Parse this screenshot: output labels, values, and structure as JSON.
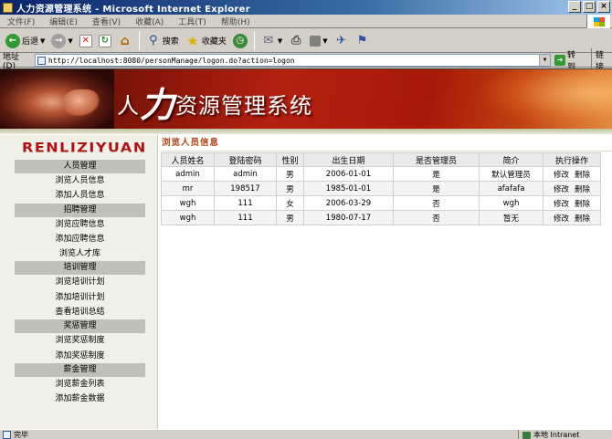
{
  "window": {
    "title": "人力资源管理系统 - Microsoft Internet Explorer",
    "controls": [
      "_",
      "□",
      "×"
    ]
  },
  "menu": [
    "文件(F)",
    "编辑(E)",
    "查看(V)",
    "收藏(A)",
    "工具(T)",
    "帮助(H)"
  ],
  "toolbar": {
    "back_label": "后退",
    "search_label": "搜索",
    "favorites_label": "收藏夹"
  },
  "address": {
    "label": "地址(D)",
    "url": "http://localhost:8080/personManage/logon.do?action=logon",
    "go_label": "转到",
    "links_label": "链接"
  },
  "banner": {
    "title_prefix": "人",
    "title_big": "力",
    "title_rest": "资源管理系统"
  },
  "sidebar": {
    "brand": "RENLIZIYUAN",
    "sections": [
      {
        "title": "人员管理",
        "items": [
          "浏览人员信息",
          "添加人员信息"
        ]
      },
      {
        "title": "招聘管理",
        "items": [
          "浏览应聘信息",
          "添加应聘信息",
          "浏览人才库"
        ]
      },
      {
        "title": "培训管理",
        "items": [
          "浏览培训计划",
          "添加培训计划",
          "查看培训总结"
        ]
      },
      {
        "title": "奖惩管理",
        "items": [
          "浏览奖惩制度",
          "添加奖惩制度"
        ]
      },
      {
        "title": "薪金管理",
        "items": [
          "浏览薪金列表",
          "添加薪金数据"
        ]
      }
    ]
  },
  "main": {
    "title": "浏览人员信息",
    "columns": [
      "人员姓名",
      "登陆密码",
      "性别",
      "出生日期",
      "是否管理员",
      "简介",
      "执行操作"
    ],
    "rows": [
      {
        "name": "admin",
        "password": "admin",
        "gender": "男",
        "birth": "2006-01-01",
        "admin": "是",
        "intro": "默认管理员"
      },
      {
        "name": "mr",
        "password": "198517",
        "gender": "男",
        "birth": "1985-01-01",
        "admin": "是",
        "intro": "afafafa"
      },
      {
        "name": "wgh",
        "password": "111",
        "gender": "女",
        "birth": "2006-03-29",
        "admin": "否",
        "intro": "wgh"
      },
      {
        "name": "wgh",
        "password": "111",
        "gender": "男",
        "birth": "1980-07-17",
        "admin": "否",
        "intro": "暂无"
      }
    ],
    "action_edit": "修改",
    "action_delete": "删除"
  },
  "status": {
    "text": "完毕",
    "zone": "本地 Intranet"
  }
}
